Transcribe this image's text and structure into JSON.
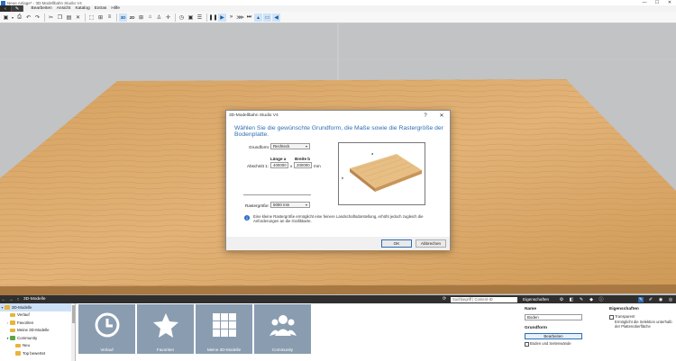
{
  "window": {
    "title": "Neue Anlage* - 3D-Modellbahn Studio V4",
    "minimize": "—",
    "maximize": "☐",
    "close": "✕"
  },
  "menu": {
    "back": "‹",
    "edit": "✎",
    "items": [
      "Bearbeiten",
      "Ansicht",
      "Katalog",
      "Extras",
      "Hilfe"
    ]
  },
  "toolbar": {
    "view_3d": "3D",
    "view_2d": "2D"
  },
  "dialog": {
    "title": "3D-Modellbahn Studio V4",
    "help": "?",
    "close": "✕",
    "headline": "Wählen Sie die gewünschte Grundform, die Maße sowie die Rastergröße der Bodenplatte.",
    "shape_label": "Grundform:",
    "shape_value": "Rechteck",
    "length_header": "Länge a",
    "width_header": "Breite b",
    "section_label": "Abschnitt 1:",
    "length_value": "400000",
    "times": "x",
    "width_value": "200000",
    "unit": "mm",
    "grid_label": "Rastergröße:",
    "grid_value": "5000 mm",
    "preview_a": "a",
    "preview_b": "b",
    "info": "Eine kleine Rastergröße ermöglicht eine feinere Landschaftsdarstellung, erhöht jedoch zugleich die Anforderungen an die Grafikkarte.",
    "ok": "OK",
    "cancel": "Abbrechen"
  },
  "bottom": {
    "section_title": "3D-Modelle",
    "search_placeholder": "Suchbegriff | Content-ID",
    "properties_title": "Eigenschaften"
  },
  "tree": {
    "items": [
      {
        "label": "3D-Modelle",
        "selected": true
      },
      {
        "label": "Verlauf"
      },
      {
        "label": "Favoriten"
      },
      {
        "label": "Meine 3D-Modelle"
      },
      {
        "label": "Community"
      },
      {
        "label": "Neu"
      },
      {
        "label": "Top bewertet"
      }
    ]
  },
  "catalog": {
    "tiles": [
      {
        "label": "Verlauf",
        "icon": "clock-icon"
      },
      {
        "label": "Favoriten",
        "icon": "star-icon"
      },
      {
        "label": "Meine 3D-Modelle",
        "icon": "grid-icon"
      },
      {
        "label": "Community",
        "icon": "people-icon"
      }
    ]
  },
  "properties": {
    "name_label": "Name",
    "name_value": "Boden",
    "shape_label": "Grundform",
    "edit_button": "Bearbeiten",
    "walls_label": "Boden und Seitenwände",
    "right_title": "Eigenschaften",
    "transparent_label": "Transparent",
    "transparent_desc": "Ermöglicht die Selektion unterhalb der Plattenoberfläche"
  },
  "colors": {
    "accent": "#2e6db4",
    "dark_bar": "#2f2f2f",
    "wood": "#d9a766",
    "tile": "#8a9cb0"
  }
}
